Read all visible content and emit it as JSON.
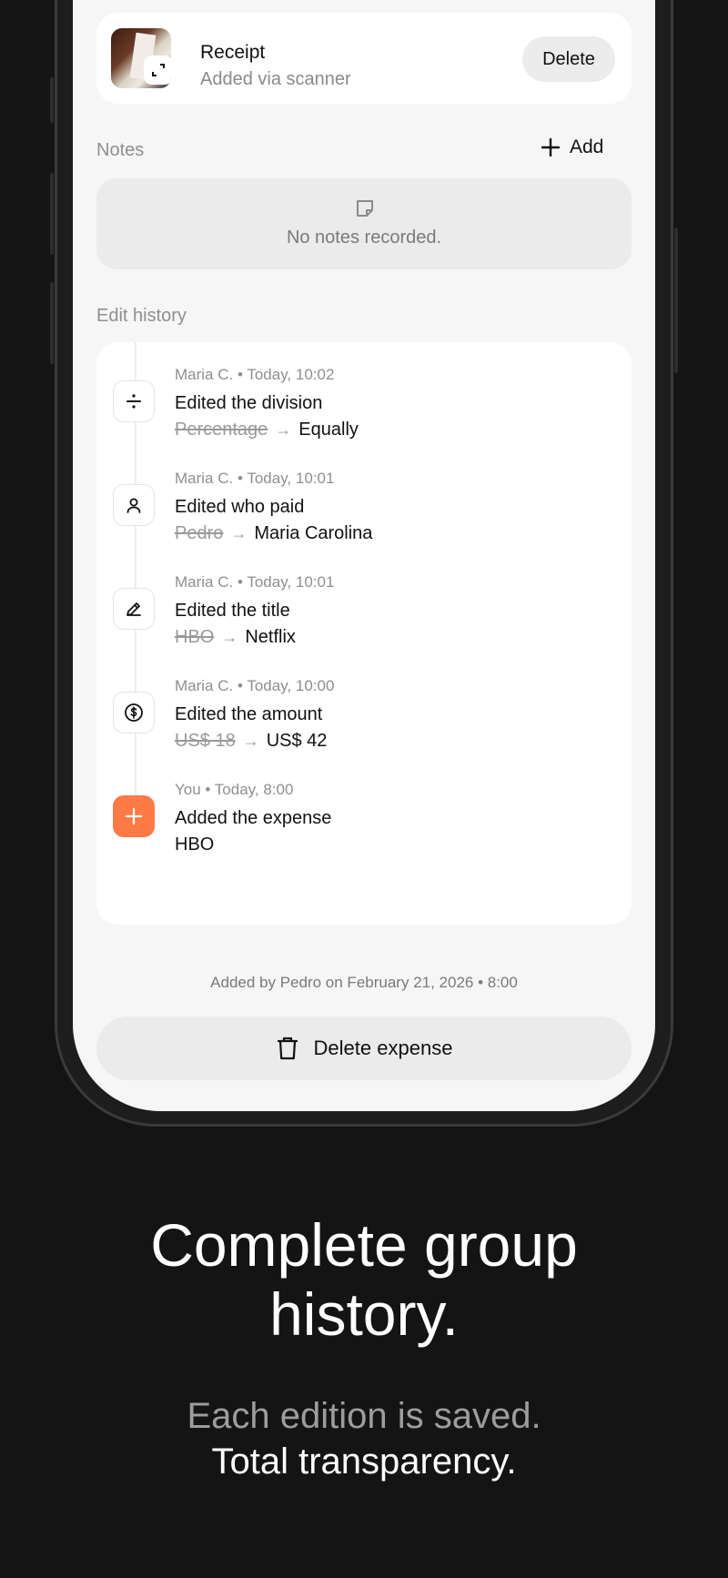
{
  "receipt": {
    "title": "Receipt",
    "subtitle": "Added via scanner",
    "delete_label": "Delete"
  },
  "notes": {
    "label": "Notes",
    "add_label": "Add",
    "empty_text": "No notes recorded."
  },
  "history": {
    "label": "Edit history",
    "items": [
      {
        "icon": "divide-icon",
        "author": "Maria C.",
        "time": "Today, 10:02",
        "action": "Edited the division",
        "old": "Percentage",
        "new": "Equally"
      },
      {
        "icon": "user-icon",
        "author": "Maria C.",
        "time": "Today, 10:01",
        "action": "Edited who paid",
        "old": "Pedro",
        "new": "Maria Carolina"
      },
      {
        "icon": "pencil-icon",
        "author": "Maria C.",
        "time": "Today, 10:01",
        "action": "Edited the title",
        "old": "HBO",
        "new": "Netflix"
      },
      {
        "icon": "dollar-circle-icon",
        "author": "Maria C.",
        "time": "Today, 10:00",
        "action": "Edited the amount",
        "old": "US$ 18",
        "new": "US$ 42"
      },
      {
        "icon": "plus-icon",
        "author": "You",
        "time": "Today, 8:00",
        "action": "Added the expense",
        "new": "HBO"
      }
    ]
  },
  "footer": {
    "added_by": "Added by Pedro on February 21, 2026 • 8:00",
    "delete_label": "Delete expense"
  },
  "marketing": {
    "headline_line1": "Complete group",
    "headline_line2": "history.",
    "sub_line1": "Each edition is saved.",
    "sub_line2": "Total transparency."
  },
  "colors": {
    "accent": "#ff7a45",
    "background": "#141414",
    "screen": "#f6f6f6"
  }
}
